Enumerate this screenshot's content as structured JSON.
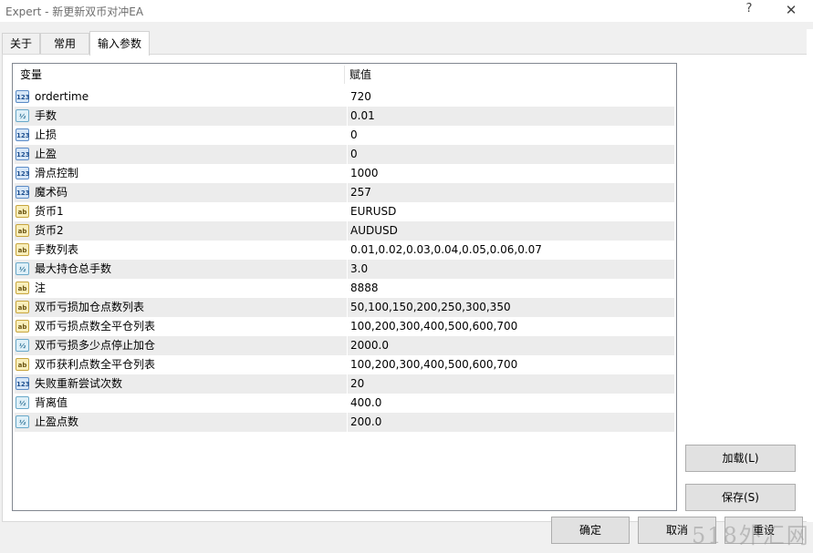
{
  "window": {
    "title": "Expert - 新更新双币对冲EA",
    "help_label": "?",
    "close_label": "✕"
  },
  "tabs": [
    {
      "label": "关于"
    },
    {
      "label": "常用"
    },
    {
      "label": "输入参数"
    }
  ],
  "grid": {
    "header_variable": "变量",
    "header_value": "赋值",
    "rows": [
      {
        "icon": "int",
        "name": "ordertime",
        "value": "720"
      },
      {
        "icon": "double",
        "name": "手数",
        "value": "0.01"
      },
      {
        "icon": "int",
        "name": "止损",
        "value": "0"
      },
      {
        "icon": "int",
        "name": "止盈",
        "value": "0"
      },
      {
        "icon": "int",
        "name": "滑点控制",
        "value": "1000"
      },
      {
        "icon": "int",
        "name": "魔术码",
        "value": "257"
      },
      {
        "icon": "string",
        "name": "货币1",
        "value": "EURUSD"
      },
      {
        "icon": "string",
        "name": "货币2",
        "value": "AUDUSD"
      },
      {
        "icon": "string",
        "name": "手数列表",
        "value": "0.01,0.02,0.03,0.04,0.05,0.06,0.07"
      },
      {
        "icon": "double",
        "name": "最大持仓总手数",
        "value": "3.0"
      },
      {
        "icon": "string",
        "name": "注",
        "value": "8888"
      },
      {
        "icon": "string",
        "name": "双币亏损加仓点数列表",
        "value": "50,100,150,200,250,300,350"
      },
      {
        "icon": "string",
        "name": "双币亏损点数全平仓列表",
        "value": "100,200,300,400,500,600,700"
      },
      {
        "icon": "double",
        "name": "双币亏损多少点停止加仓",
        "value": "2000.0"
      },
      {
        "icon": "string",
        "name": "双币获利点数全平仓列表",
        "value": "100,200,300,400,500,600,700"
      },
      {
        "icon": "int",
        "name": "失败重新尝试次数",
        "value": "20"
      },
      {
        "icon": "double",
        "name": "背离值",
        "value": "400.0"
      },
      {
        "icon": "double",
        "name": "止盈点数",
        "value": "200.0"
      }
    ]
  },
  "icon_glyphs": {
    "int": "123",
    "double": "½",
    "string": "ab"
  },
  "buttons": {
    "load": "加载(L)",
    "save": "保存(S)",
    "ok": "确定",
    "cancel": "取消",
    "reset": "重设"
  },
  "watermark": "518外汇网"
}
